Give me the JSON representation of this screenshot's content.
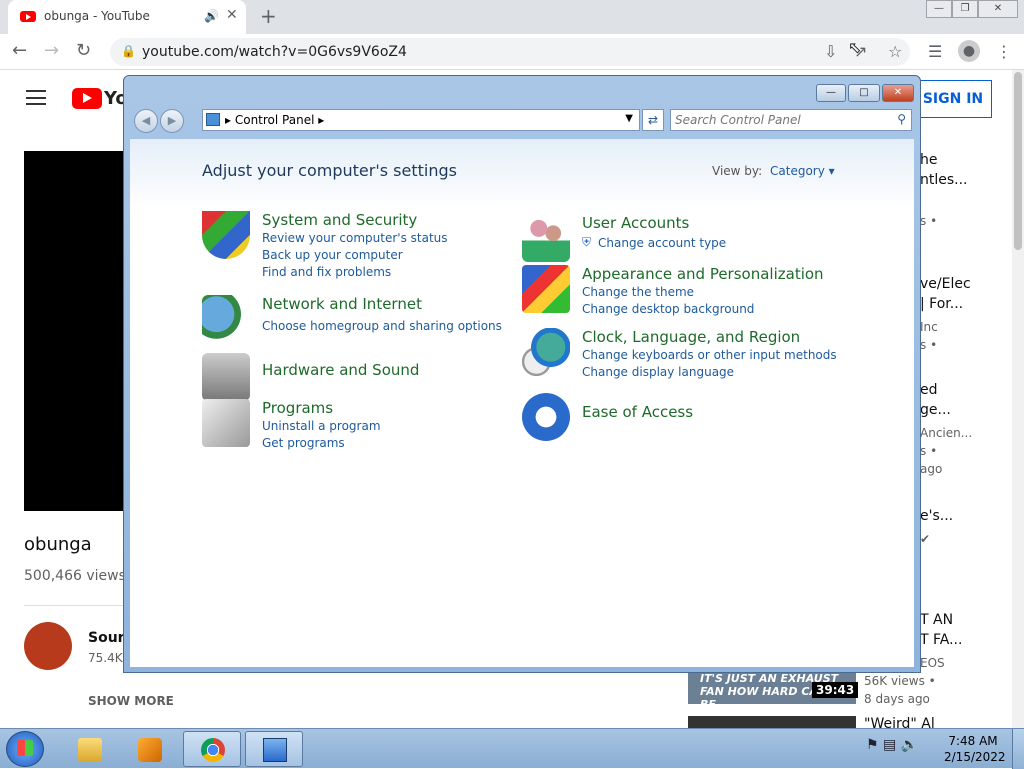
{
  "browser": {
    "tab_title": "obunga - YouTube",
    "url": "youtube.com/watch?v=0G6vs9V6oZ4"
  },
  "youtube": {
    "logo_text": "Yo",
    "sign_in": "SIGN IN",
    "video_title": "obunga",
    "views": "500,466 views •",
    "channel_name": "Sour",
    "subscribers": "75.4K",
    "show_more": "SHOW MORE",
    "sidebar": [
      {
        "text": "he"
      },
      {
        "text": "ntles..."
      },
      {
        "text": "s •"
      },
      {
        "text": "ve/Elec"
      },
      {
        "text": "| For..."
      },
      {
        "text": "Inc"
      },
      {
        "text": "s •"
      },
      {
        "text": "ed"
      },
      {
        "text": "ge..."
      },
      {
        "text": "Ancien..."
      },
      {
        "text": "s •"
      },
      {
        "text": "ago"
      },
      {
        "text": "e's..."
      },
      {
        "text": "T AN"
      },
      {
        "text": "T FA..."
      },
      {
        "text": "EOS"
      }
    ],
    "thumb_text": "IT'S JUST AN EXHAUST FAN HOW HARD CAN IT BE",
    "duration": "39:43",
    "thumb_views": "56K views •",
    "thumb_date": "8 days ago",
    "next_title": "\"Weird\" Al"
  },
  "control_panel": {
    "breadcrumb": "Control Panel",
    "search_placeholder": "Search Control Panel",
    "heading": "Adjust your computer's settings",
    "view_by_label": "View by:",
    "view_by_value": "Category",
    "categories": [
      {
        "title": "System and Security",
        "links": [
          "Review your computer's status",
          "Back up your computer",
          "Find and fix problems"
        ]
      },
      {
        "title": "Network and Internet",
        "links": [
          "Choose homegroup and sharing options"
        ]
      },
      {
        "title": "Hardware and Sound",
        "links": []
      },
      {
        "title": "Programs",
        "links": [
          "Uninstall a program",
          "Get programs"
        ]
      },
      {
        "title": "User Accounts",
        "links": [
          "Change account type"
        ]
      },
      {
        "title": "Appearance and Personalization",
        "links": [
          "Change the theme",
          "Change desktop background"
        ]
      },
      {
        "title": "Clock, Language, and Region",
        "links": [
          "Change keyboards or other input methods",
          "Change display language"
        ]
      },
      {
        "title": "Ease of Access",
        "links": []
      }
    ]
  },
  "taskbar": {
    "time": "7:48 AM",
    "date": "2/15/2022"
  },
  "colors": {
    "accent": "#1e5a9b",
    "category_title": "#1e6a2a",
    "youtube_red": "#ff0000"
  }
}
